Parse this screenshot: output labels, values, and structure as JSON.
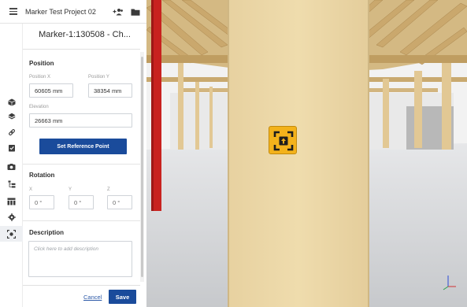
{
  "header": {
    "project_title": "Marker Test Project 02",
    "menu_icon": "hamburger-menu-icon",
    "add_user_icon": "add-people-icon",
    "folder_icon": "folder-icon"
  },
  "toolstrip": {
    "tools": [
      {
        "name": "box-icon"
      },
      {
        "name": "layers-icon"
      },
      {
        "name": "link-icon"
      },
      {
        "name": "checklist-icon"
      },
      {
        "name": "camera-icon"
      },
      {
        "name": "hierarchy-icon"
      },
      {
        "name": "table-icon"
      },
      {
        "name": "settings-icon"
      },
      {
        "name": "marker-icon",
        "active": true
      }
    ]
  },
  "panel": {
    "marker_title": "Marker-1:130508 - Ch...",
    "position": {
      "label": "Position",
      "x_label": "Position X",
      "x_value": "60605 mm",
      "y_label": "Position Y",
      "y_value": "38354 mm",
      "elevation_label": "Elevation",
      "elevation_value": "26663 mm"
    },
    "set_reference_label": "Set Reference Point",
    "rotation": {
      "label": "Rotation",
      "x_label": "X",
      "x_value": "0 °",
      "y_label": "Y",
      "y_value": "0 °",
      "z_label": "Z",
      "z_value": "0 °"
    },
    "description": {
      "label": "Description",
      "placeholder": "Click here to add description"
    },
    "cancel_label": "Cancel",
    "save_label": "Save"
  },
  "viewport": {
    "colors": {
      "sky": "#f4f4f4",
      "floor": "#cfd1d4",
      "column": "#ecd7a6",
      "beam": "#d9bf87",
      "red_column": "#c8221f",
      "marker": "#f3b21b"
    }
  }
}
